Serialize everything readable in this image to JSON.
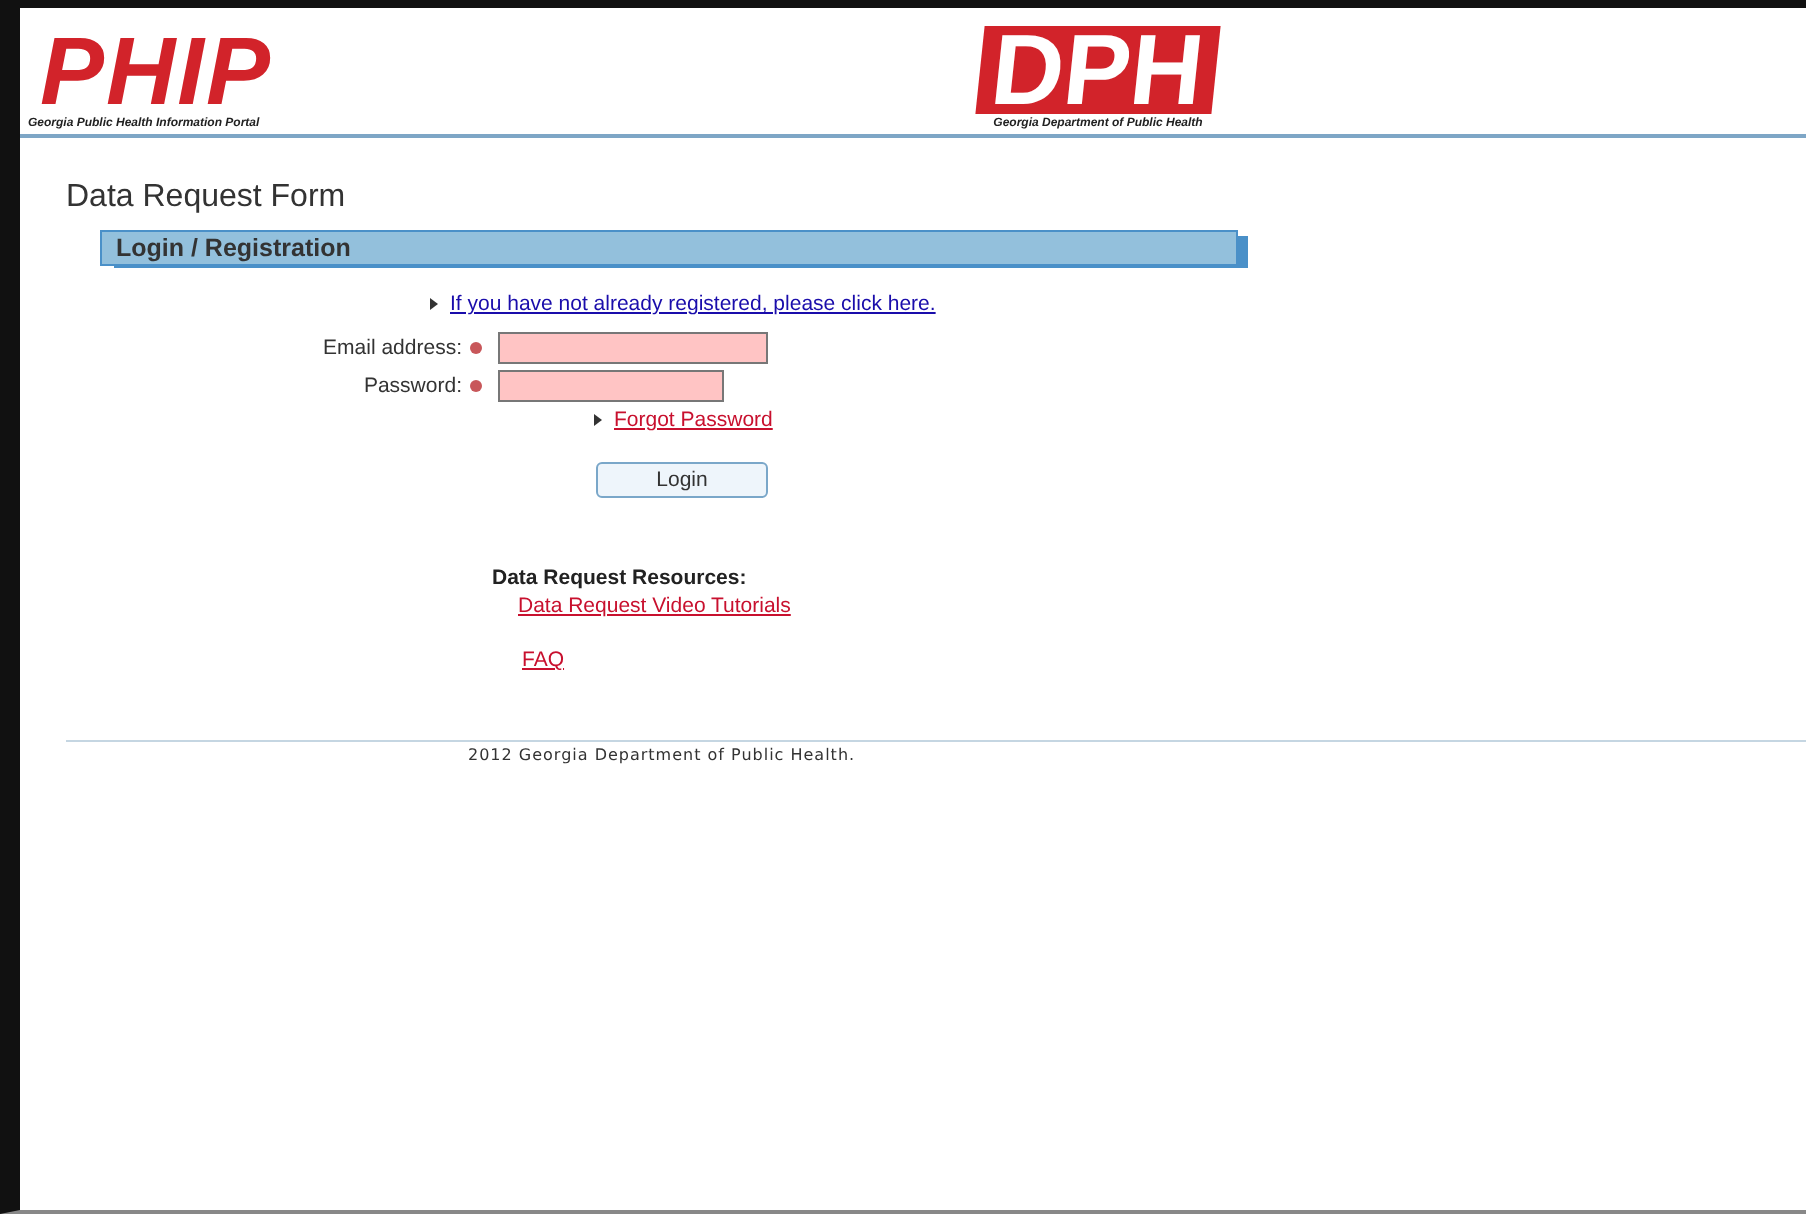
{
  "header": {
    "left_logo": {
      "text": "PHIP",
      "subtitle": "Georgia Public Health Information Portal"
    },
    "right_logo": {
      "text": "DPH",
      "subtitle": "Georgia Department of Public Health"
    }
  },
  "page_title": "Data Request Form",
  "section": {
    "title": "Login / Registration"
  },
  "register_link": "If you have not already registered, please click here.",
  "fields": [
    {
      "label": "Email address:",
      "required": true,
      "kind": "text"
    },
    {
      "label": "Password:",
      "required": true,
      "kind": "password"
    }
  ],
  "forgot_link": "Forgot Password",
  "login_button": "Login",
  "resources": {
    "heading": "Data Request Resources:",
    "links": [
      "Data Request Video Tutorials",
      "FAQ"
    ]
  },
  "footer": "2012 Georgia Department of Public Health."
}
